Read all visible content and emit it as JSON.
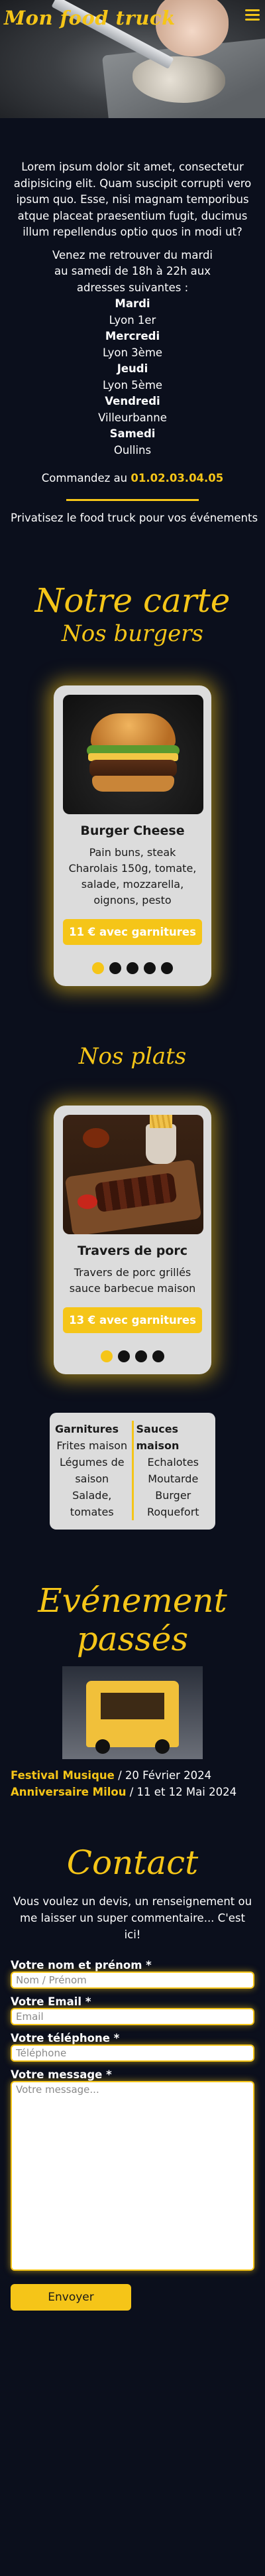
{
  "header": {
    "brand": "Mon food truck",
    "menu_icon": "hamburger-menu-icon"
  },
  "intro": {
    "lorem": "Lorem ipsum dolor sit amet, consectetur adipisicing elit. Quam suscipit corrupti vero ipsum quo. Esse, nisi magnam temporibus atque placeat praesentium fugit, ducimus illum repellendus optio quos in modi ut?",
    "schedule_intro_1": "Venez me retrouver du mardi",
    "schedule_intro_2": "au samedi de 18h à 22h aux",
    "schedule_intro_3": "adresses suivantes :",
    "days": [
      {
        "day": "Mardi",
        "place": "Lyon 1er"
      },
      {
        "day": "Mercredi",
        "place": "Lyon 3ème"
      },
      {
        "day": "Jeudi",
        "place": "Lyon 5ème"
      },
      {
        "day": "Vendredi",
        "place": "Villeurbanne"
      },
      {
        "day": "Samedi",
        "place": "Oullins"
      }
    ],
    "order_text": "Commandez au",
    "phone": "01.02.03.04.05",
    "private_text": "Privatisez le food truck pour vos événements"
  },
  "menu": {
    "title": "Notre carte",
    "burgers_title": "Nos burgers",
    "burger": {
      "name": "Burger Cheese",
      "description": "Pain buns, steak Charolais 150g, tomate, salade, mozzarella, oignons, pesto",
      "price": "11 € avec garnitures"
    },
    "plats_title": "Nos plats",
    "plat": {
      "name": "Travers de porc",
      "description": "Travers de porc grillés sauce barbecue maison",
      "price": "13 € avec garnitures"
    }
  },
  "extras": {
    "garnitures_title": "Garnitures",
    "garnitures": [
      "Frites maison",
      "Légumes de saison",
      "Salade, tomates"
    ],
    "sauces_title": "Sauces maison",
    "sauces": [
      "Echalotes",
      "Moutarde",
      "Burger",
      "Roquefort"
    ]
  },
  "events": {
    "title": "Evénement passés",
    "items": [
      {
        "name": "Festival Musique",
        "date": " / 20 Février 2024"
      },
      {
        "name": "Anniversaire Milou",
        "date": " / 11 et 12 Mai 2024"
      }
    ]
  },
  "contact": {
    "title": "Contact",
    "intro": "Vous voulez un devis, un renseignement ou me laisser un super commentaire... C'est ici!",
    "name_label": "Votre nom et prénom *",
    "name_placeholder": "Nom / Prénom",
    "email_label": "Votre Email *",
    "email_placeholder": "Email",
    "phone_label": "Votre téléphone *",
    "phone_placeholder": "Téléphone",
    "message_label": "Votre message *",
    "message_placeholder": "Votre message...",
    "submit": "Envoyer"
  },
  "carousel": {
    "burger_dots": 5,
    "burger_active": 0,
    "plat_dots": 4,
    "plat_active": 0
  },
  "colors": {
    "accent": "#f5c518",
    "background": "#0b0f1c",
    "card": "#dcdcdc"
  }
}
